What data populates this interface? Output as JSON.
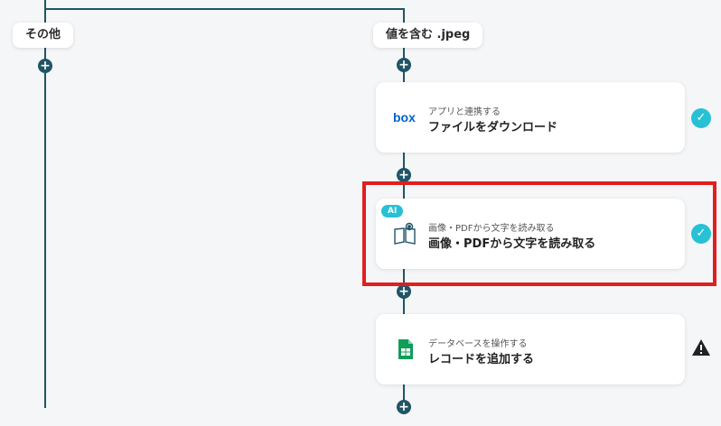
{
  "branches": {
    "left": {
      "label": "その他"
    },
    "right": {
      "label": "値を含む .jpeg"
    }
  },
  "steps": [
    {
      "subtitle": "アプリと連携する",
      "title": "ファイルをダウンロード",
      "icon": "box-logo-icon",
      "status": "complete"
    },
    {
      "subtitle": "画像・PDFから文字を読み取る",
      "title": "画像・PDFから文字を読み取る",
      "icon": "ocr-book-icon",
      "badge": "AI",
      "status": "complete",
      "highlighted": true
    },
    {
      "subtitle": "データベースを操作する",
      "title": "レコードを追加する",
      "icon": "google-sheets-icon",
      "status": "warning"
    }
  ],
  "controls": {
    "add_step_symbol": "+",
    "check_symbol": "✓"
  },
  "colors": {
    "connector": "#1f5566",
    "check": "#27c1d6",
    "highlight": "#e01f1f",
    "box_blue": "#0061d5",
    "sheets_green": "#0f9d58"
  }
}
